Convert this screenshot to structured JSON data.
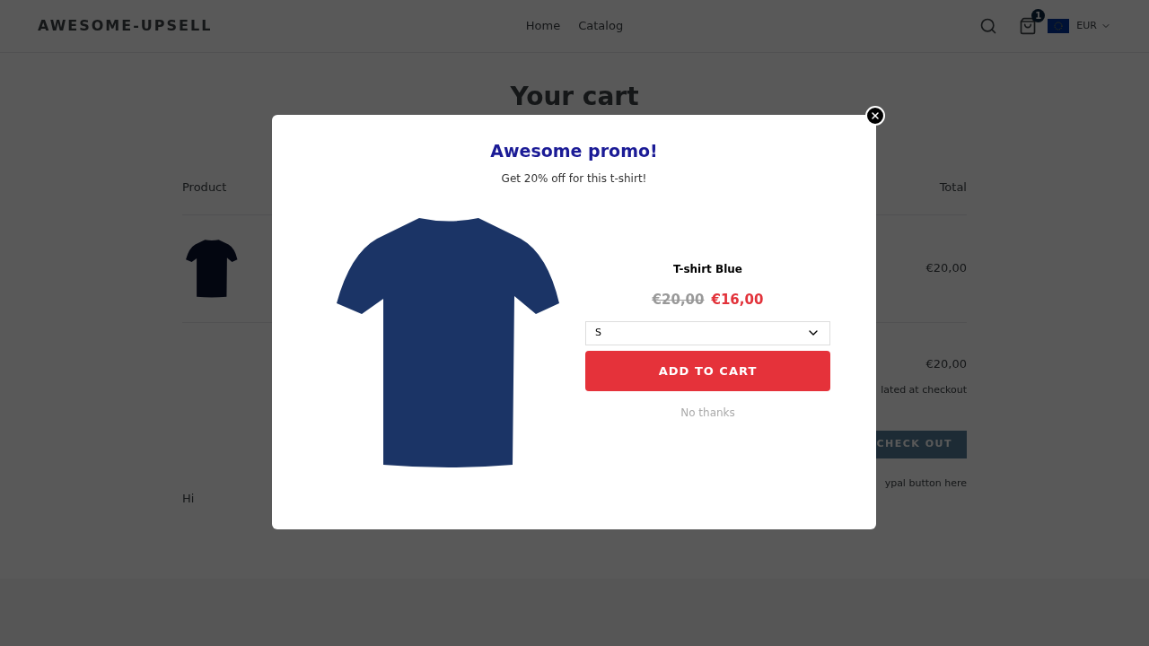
{
  "header": {
    "logo": "AWESOME-UPSELL",
    "nav": [
      {
        "label": "Home"
      },
      {
        "label": "Catalog"
      }
    ],
    "cart_count": "1",
    "currency": "EUR"
  },
  "cart": {
    "title": "Your cart",
    "columns": [
      "Product",
      "Total"
    ],
    "rows": [
      {
        "total": "€20,00"
      }
    ],
    "subtotal": "€20,00",
    "tax_note": "lated at checkout",
    "checkout_button": "CHECK OUT",
    "paypal_note": "ypal button here",
    "note": "Hi"
  },
  "modal": {
    "title": "Awesome promo!",
    "subtitle": "Get 20% off for this t-shirt!",
    "product": {
      "name": "T-shirt Blue",
      "original_price": "€20,00",
      "sale_price": "€16,00",
      "variant": "S",
      "add_button": "ADD TO CART",
      "dismiss": "No thanks"
    }
  }
}
